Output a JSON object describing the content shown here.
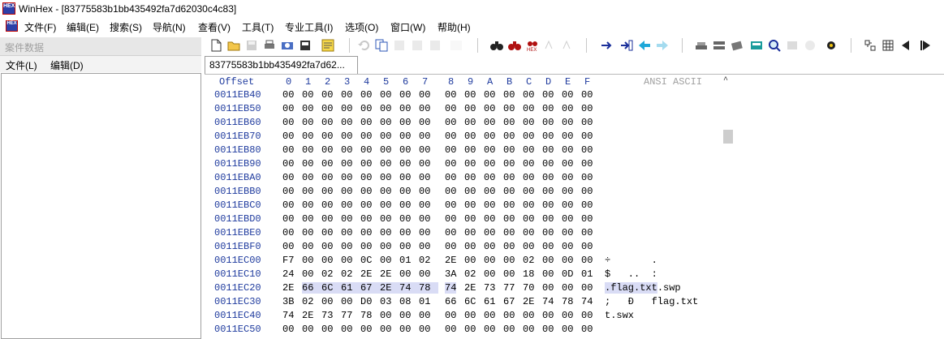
{
  "window": {
    "app_icon_text": "HEX",
    "title": "WinHex - [83775583b1bb435492fa7d62030c4c83]"
  },
  "menubar": {
    "icon_text": "HEX",
    "items": [
      "文件(F)",
      "编辑(E)",
      "搜索(S)",
      "导航(N)",
      "查看(V)",
      "工具(T)",
      "专业工具(I)",
      "选项(O)",
      "窗口(W)",
      "帮助(H)"
    ]
  },
  "case_panel": {
    "title": "案件数据",
    "menu": [
      "文件(L)",
      "编辑(D)"
    ]
  },
  "toolbar": {
    "icons": [
      "new-file-icon",
      "open-file-icon",
      "save-icon",
      "print-icon",
      "properties-icon",
      "open-disk-icon",
      "undo-icon",
      "copy-icon",
      "cut-icon",
      "paste-icon",
      "write-icon",
      "find-text-icon",
      "find-hex-icon",
      "replace-hex-icon",
      "replace-text-icon",
      "search-next-icon",
      "goto-offset-icon",
      "goto-icon",
      "back-icon",
      "forward-icon",
      "disk-icon",
      "ram-icon",
      "interpreter-icon",
      "calculator-icon",
      "zoom-icon",
      "hash-icon",
      "recover-icon",
      "settings-icon",
      "template-icon",
      "grid-icon",
      "prev-icon",
      "next-icon"
    ]
  },
  "tab": {
    "label": "83775583b1bb435492fa7d62..."
  },
  "hex": {
    "offset_label": "Offset",
    "columns": [
      "0",
      "1",
      "2",
      "3",
      "4",
      "5",
      "6",
      "7",
      "8",
      "9",
      "A",
      "B",
      "C",
      "D",
      "E",
      "F"
    ],
    "ascii_label": "ANSI ASCII",
    "rows": [
      {
        "offset": "0011EB40",
        "bytes": [
          "00",
          "00",
          "00",
          "00",
          "00",
          "00",
          "00",
          "00",
          "00",
          "00",
          "00",
          "00",
          "00",
          "00",
          "00",
          "00"
        ],
        "ascii": ""
      },
      {
        "offset": "0011EB50",
        "bytes": [
          "00",
          "00",
          "00",
          "00",
          "00",
          "00",
          "00",
          "00",
          "00",
          "00",
          "00",
          "00",
          "00",
          "00",
          "00",
          "00"
        ],
        "ascii": ""
      },
      {
        "offset": "0011EB60",
        "bytes": [
          "00",
          "00",
          "00",
          "00",
          "00",
          "00",
          "00",
          "00",
          "00",
          "00",
          "00",
          "00",
          "00",
          "00",
          "00",
          "00"
        ],
        "ascii": ""
      },
      {
        "offset": "0011EB70",
        "bytes": [
          "00",
          "00",
          "00",
          "00",
          "00",
          "00",
          "00",
          "00",
          "00",
          "00",
          "00",
          "00",
          "00",
          "00",
          "00",
          "00"
        ],
        "ascii": ""
      },
      {
        "offset": "0011EB80",
        "bytes": [
          "00",
          "00",
          "00",
          "00",
          "00",
          "00",
          "00",
          "00",
          "00",
          "00",
          "00",
          "00",
          "00",
          "00",
          "00",
          "00"
        ],
        "ascii": ""
      },
      {
        "offset": "0011EB90",
        "bytes": [
          "00",
          "00",
          "00",
          "00",
          "00",
          "00",
          "00",
          "00",
          "00",
          "00",
          "00",
          "00",
          "00",
          "00",
          "00",
          "00"
        ],
        "ascii": ""
      },
      {
        "offset": "0011EBA0",
        "bytes": [
          "00",
          "00",
          "00",
          "00",
          "00",
          "00",
          "00",
          "00",
          "00",
          "00",
          "00",
          "00",
          "00",
          "00",
          "00",
          "00"
        ],
        "ascii": ""
      },
      {
        "offset": "0011EBB0",
        "bytes": [
          "00",
          "00",
          "00",
          "00",
          "00",
          "00",
          "00",
          "00",
          "00",
          "00",
          "00",
          "00",
          "00",
          "00",
          "00",
          "00"
        ],
        "ascii": ""
      },
      {
        "offset": "0011EBC0",
        "bytes": [
          "00",
          "00",
          "00",
          "00",
          "00",
          "00",
          "00",
          "00",
          "00",
          "00",
          "00",
          "00",
          "00",
          "00",
          "00",
          "00"
        ],
        "ascii": ""
      },
      {
        "offset": "0011EBD0",
        "bytes": [
          "00",
          "00",
          "00",
          "00",
          "00",
          "00",
          "00",
          "00",
          "00",
          "00",
          "00",
          "00",
          "00",
          "00",
          "00",
          "00"
        ],
        "ascii": ""
      },
      {
        "offset": "0011EBE0",
        "bytes": [
          "00",
          "00",
          "00",
          "00",
          "00",
          "00",
          "00",
          "00",
          "00",
          "00",
          "00",
          "00",
          "00",
          "00",
          "00",
          "00"
        ],
        "ascii": ""
      },
      {
        "offset": "0011EBF0",
        "bytes": [
          "00",
          "00",
          "00",
          "00",
          "00",
          "00",
          "00",
          "00",
          "00",
          "00",
          "00",
          "00",
          "00",
          "00",
          "00",
          "00"
        ],
        "ascii": ""
      },
      {
        "offset": "0011EC00",
        "bytes": [
          "F7",
          "00",
          "00",
          "00",
          "0C",
          "00",
          "01",
          "02",
          "2E",
          "00",
          "00",
          "00",
          "02",
          "00",
          "00",
          "00"
        ],
        "ascii": "÷       .       "
      },
      {
        "offset": "0011EC10",
        "bytes": [
          "24",
          "00",
          "02",
          "02",
          "2E",
          "2E",
          "00",
          "00",
          "3A",
          "02",
          "00",
          "00",
          "18",
          "00",
          "0D",
          "01"
        ],
        "ascii": "$   ..  :       "
      },
      {
        "offset": "0011EC20",
        "bytes": [
          "2E",
          "66",
          "6C",
          "61",
          "67",
          "2E",
          "74",
          "78",
          "74",
          "2E",
          "73",
          "77",
          "70",
          "00",
          "00",
          "00"
        ],
        "ascii": ".flag.txt.swp   "
      },
      {
        "offset": "0011EC30",
        "bytes": [
          "3B",
          "02",
          "00",
          "00",
          "D0",
          "03",
          "08",
          "01",
          "66",
          "6C",
          "61",
          "67",
          "2E",
          "74",
          "78",
          "74"
        ],
        "ascii": ";   Ð   flag.txt"
      },
      {
        "offset": "0011EC40",
        "bytes": [
          "74",
          "2E",
          "73",
          "77",
          "78",
          "00",
          "00",
          "00",
          "00",
          "00",
          "00",
          "00",
          "00",
          "00",
          "00",
          "00"
        ],
        "ascii": "t.swx           "
      },
      {
        "offset": "0011EC50",
        "bytes": [
          "00",
          "00",
          "00",
          "00",
          "00",
          "00",
          "00",
          "00",
          "00",
          "00",
          "00",
          "00",
          "00",
          "00",
          "00",
          "00"
        ],
        "ascii": ""
      }
    ],
    "highlight": {
      "row": 14,
      "bytes_from": 1,
      "bytes_to": 8,
      "ascii_from": 0,
      "ascii_to": 9,
      "color": "#d9dcf5"
    }
  },
  "colors": {
    "offset_blue": "#1f3b9e",
    "highlight": "#d9dcf5",
    "panel_gray": "#e7e7e7"
  }
}
